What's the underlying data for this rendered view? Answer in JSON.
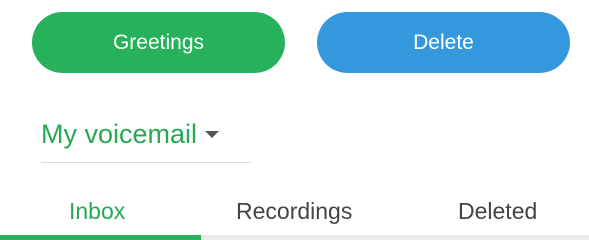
{
  "actions": {
    "greetings_label": "Greetings",
    "delete_label": "Delete"
  },
  "mailbox": {
    "selected": "My voicemail"
  },
  "tabs": [
    {
      "label": "Inbox",
      "active": true
    },
    {
      "label": "Recordings",
      "active": false
    },
    {
      "label": "Deleted",
      "active": false
    }
  ],
  "colors": {
    "greetings_button": "#27b15a",
    "delete_button": "#3598dc",
    "accent_green": "#27a852"
  }
}
